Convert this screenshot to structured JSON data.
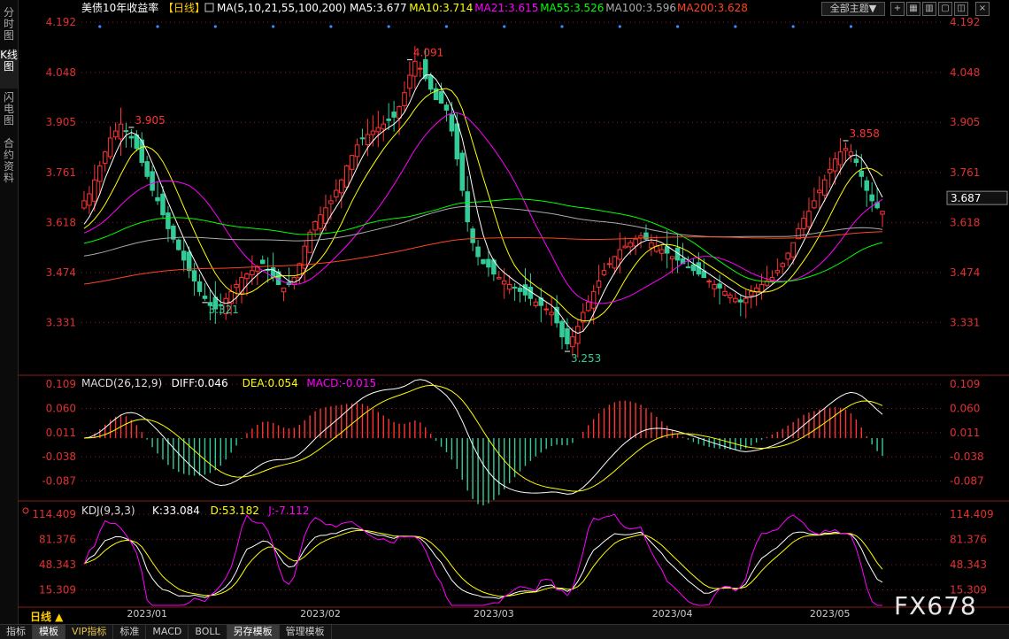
{
  "sidebar": [
    {
      "label": "分时图",
      "active": false
    },
    {
      "label": "K线图",
      "active": true
    },
    {
      "label": "闪电图",
      "active": false
    },
    {
      "label": "合约资料",
      "active": false
    }
  ],
  "header": {
    "symbol": "美债10年收益率",
    "period_tag": "【日线】",
    "ma_params": "MA(5,10,21,55,100,200)",
    "ma_values": [
      {
        "label": "MA5:3.677",
        "color": "#ffffff"
      },
      {
        "label": "MA10:3.714",
        "color": "#ffff00"
      },
      {
        "label": "MA21:3.615",
        "color": "#ff00ff"
      },
      {
        "label": "MA55:3.526",
        "color": "#00ff00"
      },
      {
        "label": "MA100:3.596",
        "color": "#aaaaaa"
      },
      {
        "label": "MA200:3.628",
        "color": "#ff4422"
      }
    ],
    "theme_label": "全部主题▼"
  },
  "period_label": "日线 ▲",
  "watermark": "FX678",
  "bottom_bar": [
    {
      "label": "指标",
      "active": false
    },
    {
      "label": "模板",
      "active": true
    },
    {
      "label": "VIP指标",
      "active": false,
      "vip": true
    },
    {
      "label": "标准",
      "active": false
    },
    {
      "label": "MACD",
      "active": false
    },
    {
      "label": "BOLL",
      "active": false
    },
    {
      "label": "另存模板",
      "active": true
    },
    {
      "label": "管理模板",
      "active": false
    }
  ],
  "colors": {
    "up": "#ff3333",
    "down": "#33cc99",
    "grid": "#8b1a1a",
    "axis_text": "#e23030"
  },
  "chart_data": [
    {
      "type": "candlestick",
      "title": "美债10年收益率【日线】",
      "ylim": [
        3.19,
        4.21
      ],
      "y_ticks": [
        "4.192",
        "4.048",
        "3.905",
        "3.761",
        "3.618",
        "3.474",
        "3.331"
      ],
      "current_price": "3.687",
      "x_labels": [
        "2023/01",
        "2023/02",
        "2023/03",
        "2023/04",
        "2023/05"
      ],
      "annotations": [
        {
          "text": "3.905",
          "index": 9,
          "kind": "high"
        },
        {
          "text": "3.321",
          "index": 23,
          "kind": "low"
        },
        {
          "text": "4.091",
          "index": 62,
          "kind": "high"
        },
        {
          "text": "3.253",
          "index": 92,
          "kind": "low"
        },
        {
          "text": "3.858",
          "index": 145,
          "kind": "high"
        }
      ],
      "closes": [
        3.68,
        3.7,
        3.74,
        3.78,
        3.82,
        3.86,
        3.88,
        3.9,
        3.88,
        3.86,
        3.83,
        3.79,
        3.75,
        3.71,
        3.68,
        3.64,
        3.6,
        3.57,
        3.54,
        3.51,
        3.48,
        3.45,
        3.42,
        3.4,
        3.38,
        3.37,
        3.38,
        3.4,
        3.42,
        3.44,
        3.46,
        3.47,
        3.48,
        3.49,
        3.5,
        3.48,
        3.46,
        3.44,
        3.43,
        3.44,
        3.46,
        3.5,
        3.55,
        3.59,
        3.62,
        3.64,
        3.66,
        3.68,
        3.71,
        3.74,
        3.78,
        3.81,
        3.84,
        3.86,
        3.87,
        3.88,
        3.89,
        3.9,
        3.91,
        3.92,
        3.95,
        3.99,
        4.04,
        4.08,
        4.06,
        4.03,
        4.0,
        3.97,
        3.96,
        3.94,
        3.88,
        3.8,
        3.71,
        3.62,
        3.56,
        3.52,
        3.5,
        3.49,
        3.47,
        3.46,
        3.45,
        3.44,
        3.43,
        3.42,
        3.41,
        3.4,
        3.39,
        3.38,
        3.37,
        3.36,
        3.33,
        3.29,
        3.27,
        3.29,
        3.32,
        3.36,
        3.39,
        3.42,
        3.45,
        3.48,
        3.5,
        3.52,
        3.54,
        3.55,
        3.56,
        3.57,
        3.58,
        3.57,
        3.56,
        3.55,
        3.54,
        3.53,
        3.52,
        3.51,
        3.5,
        3.49,
        3.48,
        3.47,
        3.46,
        3.45,
        3.44,
        3.43,
        3.42,
        3.41,
        3.4,
        3.39,
        3.4,
        3.42,
        3.43,
        3.44,
        3.45,
        3.46,
        3.48,
        3.5,
        3.53,
        3.56,
        3.6,
        3.63,
        3.65,
        3.68,
        3.71,
        3.74,
        3.77,
        3.8,
        3.82,
        3.83,
        3.82,
        3.79,
        3.75,
        3.71,
        3.68,
        3.66,
        3.65
      ],
      "series": [
        {
          "name": "MA5",
          "color": "#ffffff"
        },
        {
          "name": "MA10",
          "color": "#ffff00"
        },
        {
          "name": "MA21",
          "color": "#ff00ff"
        },
        {
          "name": "MA55",
          "color": "#00ff00"
        },
        {
          "name": "MA100",
          "color": "#aaaaaa"
        },
        {
          "name": "MA200",
          "color": "#ff4422"
        }
      ]
    },
    {
      "type": "macd",
      "title": "MACD(26,12,9)",
      "legend": [
        {
          "label": "MACD(26,12,9)",
          "color": "#dddddd"
        },
        {
          "label": "DIFF:0.046",
          "color": "#ffffff"
        },
        {
          "label": "DEA:0.054",
          "color": "#ffff00"
        },
        {
          "label": "MACD:-0.015",
          "color": "#ff00ff"
        }
      ],
      "ylim": [
        -0.12,
        0.12
      ],
      "y_ticks": [
        "0.109",
        "0.060",
        "0.011",
        "-0.038",
        "-0.087"
      ]
    },
    {
      "type": "kdj",
      "title": "KDJ(9,3,3)",
      "legend": [
        {
          "label": "KDJ(9,3,3)",
          "color": "#dddddd"
        },
        {
          "label": "K:33.084",
          "color": "#ffffff"
        },
        {
          "label": "D:53.182",
          "color": "#ffff00"
        },
        {
          "label": "J:-7.112",
          "color": "#ff00ff"
        }
      ],
      "ylim": [
        -5,
        125
      ],
      "y_ticks": [
        "114.409",
        "81.376",
        "48.343",
        "15.309"
      ]
    }
  ]
}
